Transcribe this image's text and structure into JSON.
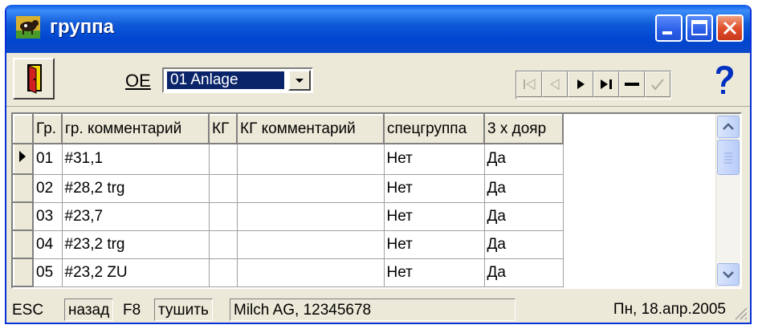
{
  "window": {
    "title": "группа"
  },
  "toolbar": {
    "oe_label": "OE",
    "oe_value": "01 Anlage",
    "icons": [
      "exit-door-icon",
      "first-record-icon",
      "prior-record-icon",
      "next-record-icon",
      "last-record-icon",
      "delete-record-icon",
      "post-record-icon",
      "help-icon"
    ]
  },
  "grid": {
    "columns": [
      "Гр.",
      "гр. комментарий",
      "КГ",
      "КГ комментарий",
      "спецгруппа",
      "3 х дояр"
    ],
    "rows": [
      [
        "01",
        "#31,1",
        "",
        "",
        "Нет",
        "Да"
      ],
      [
        "02",
        "#28,2 trg",
        "",
        "",
        "Нет",
        "Да"
      ],
      [
        "03",
        "#23,7",
        "",
        "",
        "Нет",
        "Да"
      ],
      [
        "04",
        "#23,2 trg",
        "",
        "",
        "Нет",
        "Да"
      ],
      [
        "05",
        "#23,2 ZU",
        "",
        "",
        "Нет",
        "Да"
      ]
    ]
  },
  "status": {
    "esc_key": "ESC",
    "esc_label": "назад",
    "f8_key": "F8",
    "f8_label": "тушить",
    "company": "Milch AG, 12345678",
    "date": "Пн, 18.апр.2005"
  },
  "colors": {
    "title_bar": "#0a5ae6",
    "selection": "#0a246a",
    "face": "#ece9d8"
  }
}
